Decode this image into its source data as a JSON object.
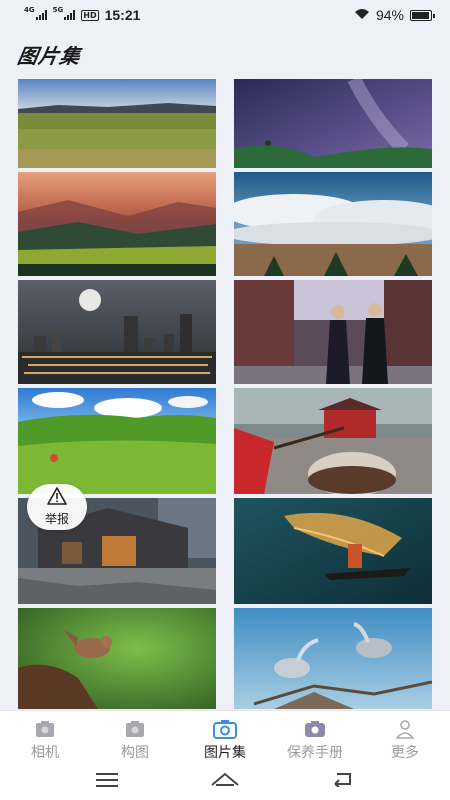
{
  "status_bar": {
    "signal1_label": "4G",
    "signal2_label": "5G",
    "hd_label": "HD",
    "time": "15:21",
    "battery_text": "94%",
    "battery_level": 0.94
  },
  "page_title": "图片集",
  "report_button": {
    "label": "举报"
  },
  "tabs": [
    {
      "label": "相机",
      "icon": "camera-icon",
      "active": false
    },
    {
      "label": "构图",
      "icon": "composition-icon",
      "active": false
    },
    {
      "label": "图片集",
      "icon": "camera-icon",
      "active": true
    },
    {
      "label": "保养手册",
      "icon": "camera-icon",
      "active": false
    },
    {
      "label": "更多",
      "icon": "person-icon",
      "active": false
    }
  ],
  "accent_color": "#3a8ee6",
  "nav_icons": [
    "menu-icon",
    "home-icon",
    "back-icon"
  ]
}
